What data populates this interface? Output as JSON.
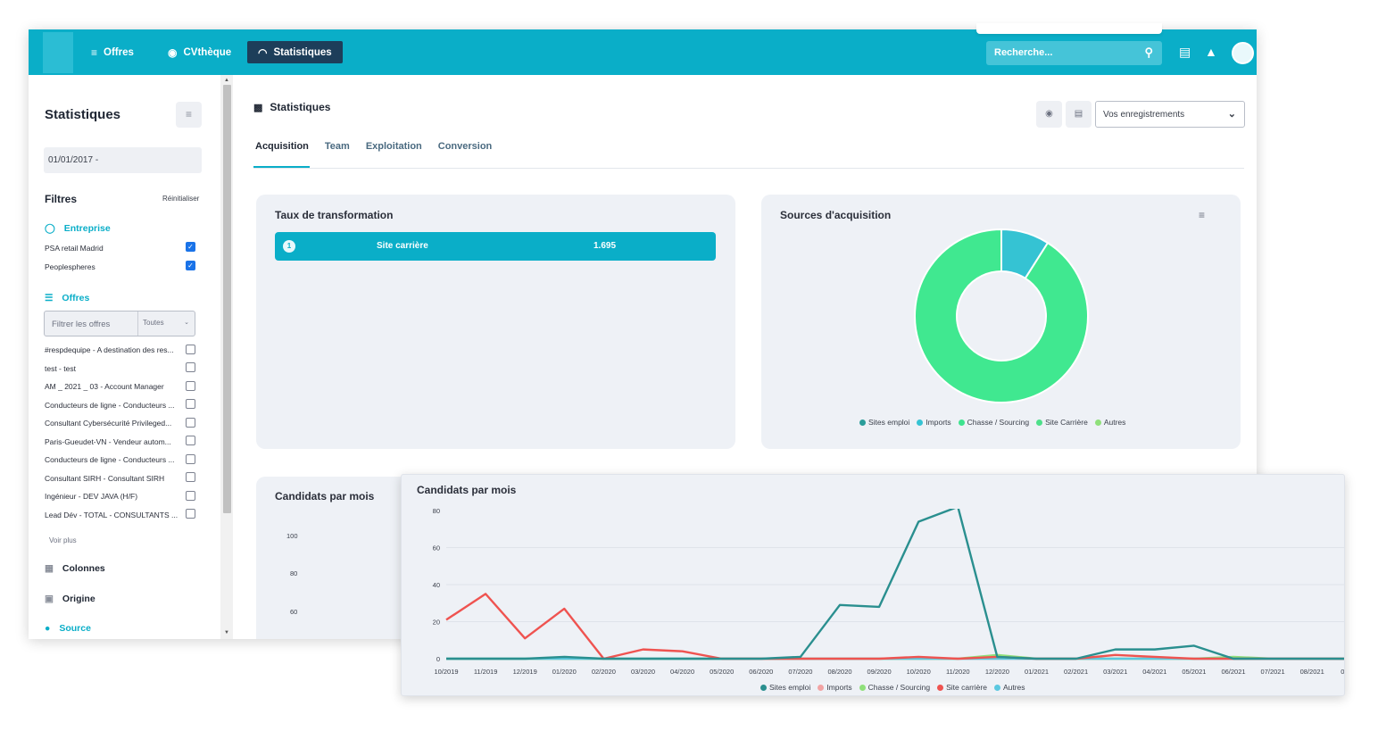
{
  "topbar": {
    "nav": [
      {
        "label": "Offres",
        "icon": "list-icon"
      },
      {
        "label": "CVthèque",
        "icon": "user-circle-icon"
      },
      {
        "label": "Statistiques",
        "icon": "spinner-icon"
      }
    ],
    "search_placeholder": "Recherche..."
  },
  "sidebar": {
    "title": "Statistiques",
    "date_range": "01/01/2017 -",
    "filters_label": "Filtres",
    "reset_label": "Réinitialiser",
    "entreprise_label": "Entreprise",
    "entreprises": [
      {
        "label": "PSA retail Madrid",
        "checked": true
      },
      {
        "label": "Peoplespheres",
        "checked": true
      }
    ],
    "offres_label": "Offres",
    "offres_filter_placeholder": "Filtrer les offres",
    "offres_select": "Toutes",
    "offres": [
      "#respdequipe - A destination des res...",
      "test - test",
      "AM _ 2021 _ 03 - Account Manager",
      "Conducteurs de ligne - Conducteurs ...",
      "Consultant Cybersécurité Privileged...",
      "Paris-Gueudet-VN - Vendeur autom...",
      "Conducteurs de ligne - Conducteurs ...",
      "Consultant SIRH - Consultant SIRH",
      "Ingénieur - DEV JAVA (H/F)",
      "Lead Dév - TOTAL - CONSULTANTS ..."
    ],
    "voir_plus": "Voir plus",
    "colonnes_label": "Colonnes",
    "origine_label": "Origine",
    "source_label": "Source"
  },
  "main": {
    "title": "Statistiques",
    "records_select": "Vos enregistrements",
    "tabs": [
      "Acquisition",
      "Team",
      "Exploitation",
      "Conversion"
    ],
    "active_tab": "Acquisition"
  },
  "taux": {
    "title": "Taux de transformation",
    "rows": [
      {
        "rank": "1",
        "label": "Site carrière",
        "value": "1.695"
      }
    ]
  },
  "colors": {
    "accent": "#0aaec8",
    "sites_emploi": "#2a9d9a",
    "imports": "#35c3d3",
    "chasse": "#3ee38f",
    "site_carriere_donut": "#3ee38f",
    "autres": "#8fe07a",
    "line_sites_emploi": "#2a8f8f",
    "line_imports": "#f2a3a3",
    "line_chasse": "#8fe07a",
    "line_site_carriere": "#ef5350",
    "line_autres": "#5bc8e0"
  },
  "chart_data": [
    {
      "type": "pie",
      "title": "Sources d'acquisition",
      "categories": [
        "Sites emploi",
        "Imports",
        "Chasse / Sourcing",
        "Site Carrière",
        "Autres"
      ],
      "values": [
        0,
        9,
        0,
        91,
        0
      ],
      "legend": "bottom"
    },
    {
      "type": "line",
      "title": "Candidats par mois",
      "yticks_background": [
        "100",
        "80",
        "60"
      ],
      "x": [
        "10/2019",
        "11/2019",
        "12/2019",
        "01/2020",
        "02/2020",
        "03/2020",
        "04/2020",
        "05/2020",
        "06/2020",
        "07/2020",
        "08/2020",
        "09/2020",
        "10/2020",
        "11/2020",
        "12/2020",
        "01/2021",
        "02/2021",
        "03/2021",
        "04/2021",
        "05/2021",
        "06/2021",
        "07/2021",
        "08/2021"
      ],
      "x_last_partial": "0",
      "ylim": [
        0,
        80
      ],
      "yticks": [
        0,
        20,
        40,
        60
      ],
      "legend": "bottom",
      "series": [
        {
          "name": "Sites emploi",
          "values": [
            0,
            0,
            0,
            1,
            0,
            0,
            0,
            0,
            0,
            1,
            29,
            28,
            74,
            82,
            1,
            0,
            0,
            5,
            5,
            7,
            0,
            0,
            0
          ]
        },
        {
          "name": "Imports",
          "values": [
            0,
            0,
            0,
            0,
            0,
            0,
            0,
            0,
            0,
            0,
            0,
            0,
            0,
            0,
            0,
            0,
            0,
            0,
            0,
            0,
            0,
            0,
            0
          ]
        },
        {
          "name": "Chasse / Sourcing",
          "values": [
            0,
            0,
            0,
            0,
            0,
            0,
            0,
            0,
            0,
            0,
            0,
            0,
            0,
            0,
            2,
            0,
            0,
            0,
            0,
            0,
            1,
            0,
            0
          ]
        },
        {
          "name": "Site carrière",
          "values": [
            21,
            35,
            11,
            27,
            0,
            5,
            4,
            0,
            0,
            0,
            0,
            0,
            1,
            0,
            1,
            0,
            0,
            2,
            1,
            0,
            0,
            0,
            0
          ]
        },
        {
          "name": "Autres",
          "values": [
            0,
            0,
            0,
            0,
            0,
            0,
            0,
            0,
            0,
            0,
            0,
            0,
            0,
            0,
            0,
            0,
            0,
            0,
            0,
            0,
            0,
            0,
            0
          ]
        }
      ]
    }
  ]
}
